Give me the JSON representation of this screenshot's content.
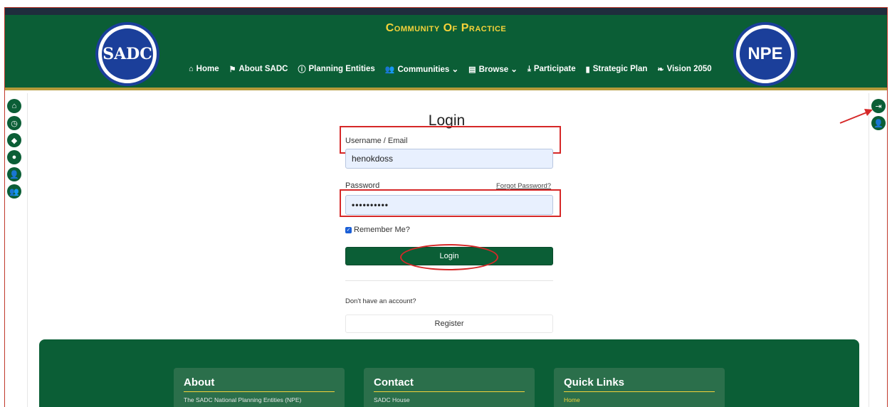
{
  "header": {
    "brand": "Community Of Practice",
    "left_logo_text": "SADC",
    "right_logo_text": "NPE",
    "nav": [
      {
        "icon": "home-icon",
        "glyph": "⌂",
        "label": "Home"
      },
      {
        "icon": "flag-icon",
        "glyph": "⚑",
        "label": "About SADC"
      },
      {
        "icon": "info-icon",
        "glyph": "ⓘ",
        "label": "Planning Entities"
      },
      {
        "icon": "users-icon",
        "glyph": "👥",
        "label": "Communities ⌄"
      },
      {
        "icon": "browse-icon",
        "glyph": "▤",
        "label": "Browse ⌄"
      },
      {
        "icon": "download-icon",
        "glyph": "⤓",
        "label": "Participate"
      },
      {
        "icon": "chart-icon",
        "glyph": "▮",
        "label": "Strategic Plan"
      },
      {
        "icon": "leaf-icon",
        "glyph": "❧",
        "label": "Vision 2050"
      }
    ]
  },
  "left_rail": [
    {
      "name": "home-icon",
      "glyph": "⌂"
    },
    {
      "name": "clock-icon",
      "glyph": "◷"
    },
    {
      "name": "tag-icon",
      "glyph": "◆"
    },
    {
      "name": "fire-icon",
      "glyph": "●"
    },
    {
      "name": "user-icon",
      "glyph": "👤"
    },
    {
      "name": "group-icon",
      "glyph": "👥"
    }
  ],
  "right_rail": [
    {
      "name": "sign-in-icon",
      "glyph": "⇥"
    },
    {
      "name": "user-plus-icon",
      "glyph": "👤"
    }
  ],
  "login": {
    "title": "Login",
    "username_label": "Username / Email",
    "username_value": "henokdoss",
    "password_label": "Password",
    "password_value": "••••••••••",
    "forgot_label": "Forgot Password?",
    "remember_label": "Remember Me?",
    "remember_checked": true,
    "login_button": "Login",
    "no_account_text": "Don't have an account?",
    "register_button": "Register"
  },
  "footer": {
    "about_title": "About",
    "about_text": "The SADC National Planning Entities (NPE)",
    "contact_title": "Contact",
    "contact_text": "SADC House",
    "links_title": "Quick Links",
    "links_first": "Home"
  },
  "colors": {
    "primary_green": "#0b5e36",
    "gold": "#f5d33a",
    "annotation_red": "#d62828"
  }
}
